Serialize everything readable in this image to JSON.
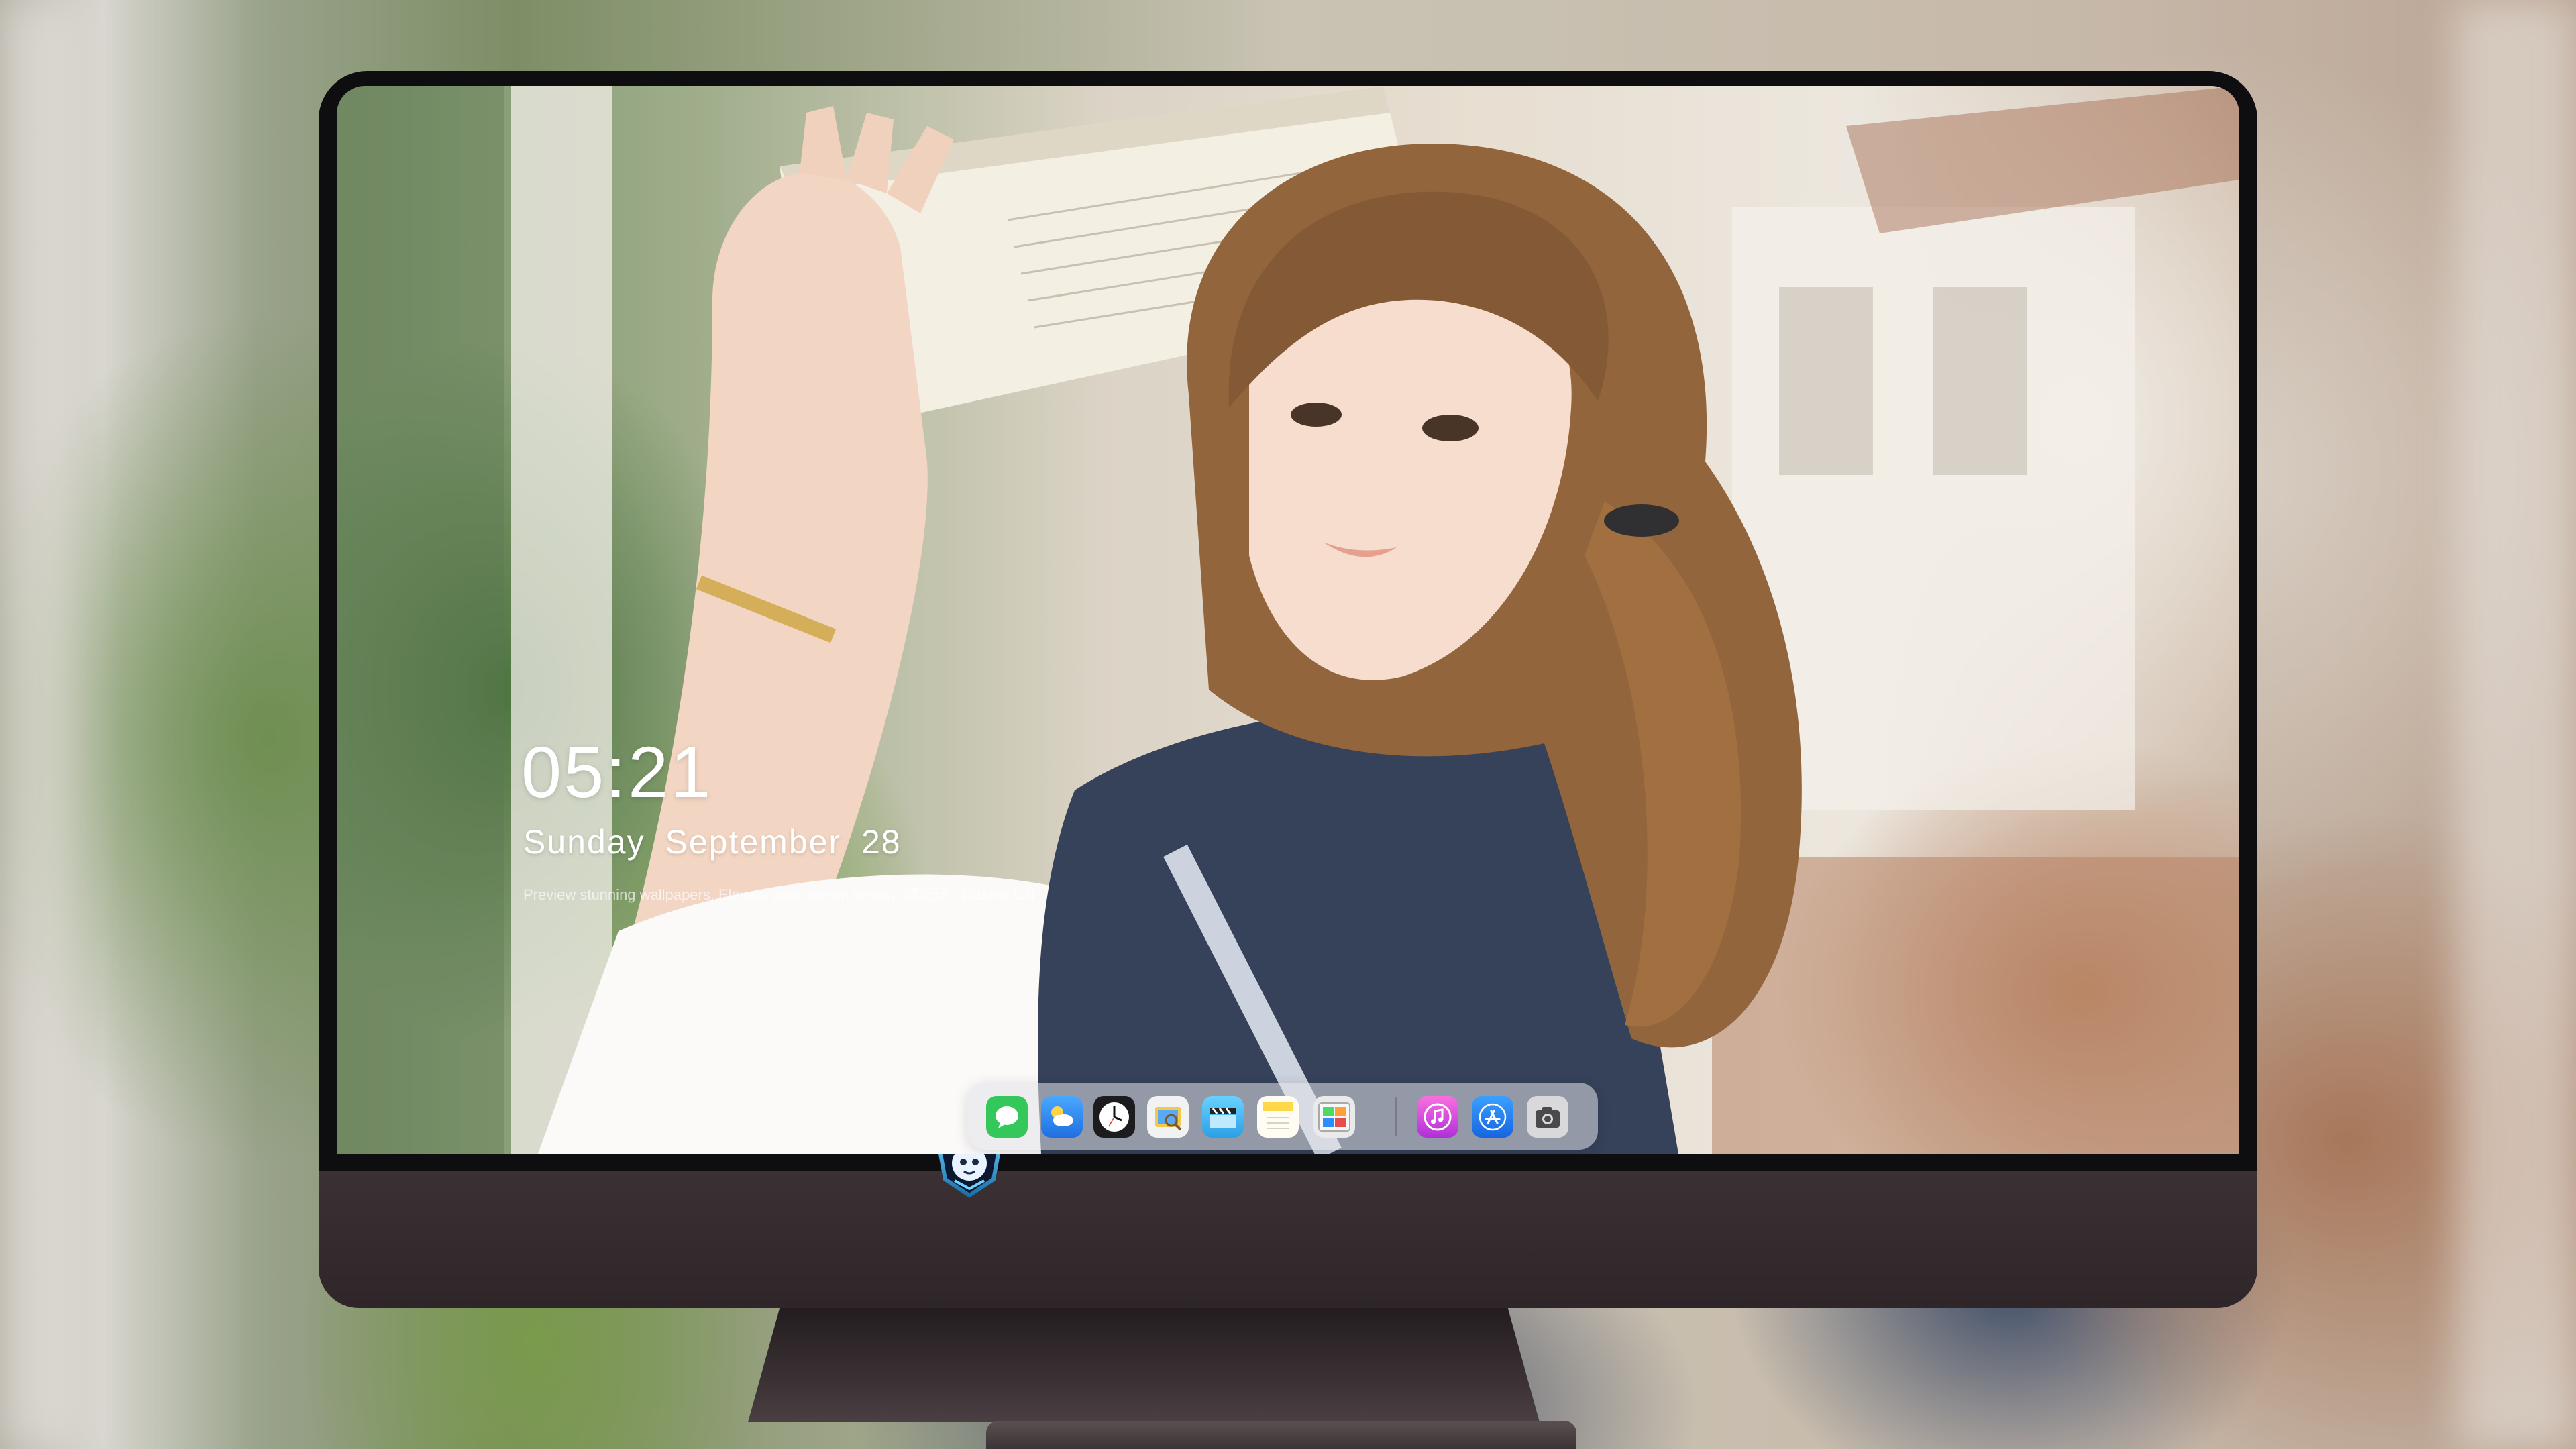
{
  "clock": {
    "time": "05:21",
    "weekday": "Sunday",
    "month": "September",
    "day": "28",
    "tagline": "Preview stunning wallpapers. Elevate your screen beauty. 壁纸迷 · Bizhimi.CN"
  },
  "dock": {
    "apps": [
      {
        "name": "messages-icon",
        "color": "#34c759"
      },
      {
        "name": "weather-icon",
        "color": "#2f8cff"
      },
      {
        "name": "clock-icon",
        "color": "#1c1c1e"
      },
      {
        "name": "preview-icon",
        "color": "#f2c94c"
      },
      {
        "name": "video-editor-icon",
        "color": "#5ac8fa"
      },
      {
        "name": "notes-icon",
        "color": "#ffd84a"
      },
      {
        "name": "photo-booth-icon",
        "color": "#4cd964"
      },
      {
        "name": "music-icon",
        "color": "#e94bd6"
      },
      {
        "name": "app-store-icon",
        "color": "#1e7cf2"
      },
      {
        "name": "camera-icon",
        "color": "#4a4a4e"
      }
    ]
  },
  "monitor": {
    "logo": "shield-mascot-logo",
    "bezel_color": "#0e0d10",
    "chin_color": "#352c2f"
  }
}
